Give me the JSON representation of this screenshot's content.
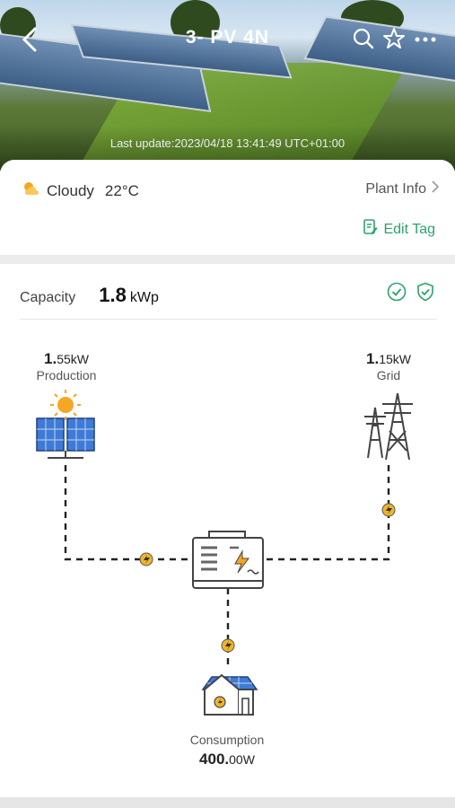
{
  "header": {
    "title": "3- PV 4N",
    "last_update": "Last update:2023/04/18 13:41:49 UTC+01:00",
    "icons": [
      "back-icon",
      "search-icon",
      "star-icon",
      "more-icon"
    ]
  },
  "weather": {
    "condition": "Cloudy",
    "temperature": "22°C",
    "icon": "cloud-sun-icon"
  },
  "plant_info_label": "Plant Info",
  "edit_tag_label": "Edit Tag",
  "capacity": {
    "label": "Capacity",
    "value": "1.8",
    "unit": "kWp"
  },
  "production": {
    "value_main": "1.",
    "value_small": "55kW",
    "label": "Production"
  },
  "grid": {
    "value_main": "1.",
    "value_small": "15kW",
    "label": "Grid"
  },
  "consumption": {
    "value_main": "400.",
    "value_small": "00W",
    "label": "Consumption"
  },
  "colors": {
    "accent_green": "#2aa36b",
    "flow_dot": "#f0b429",
    "text_dark": "#222222"
  }
}
